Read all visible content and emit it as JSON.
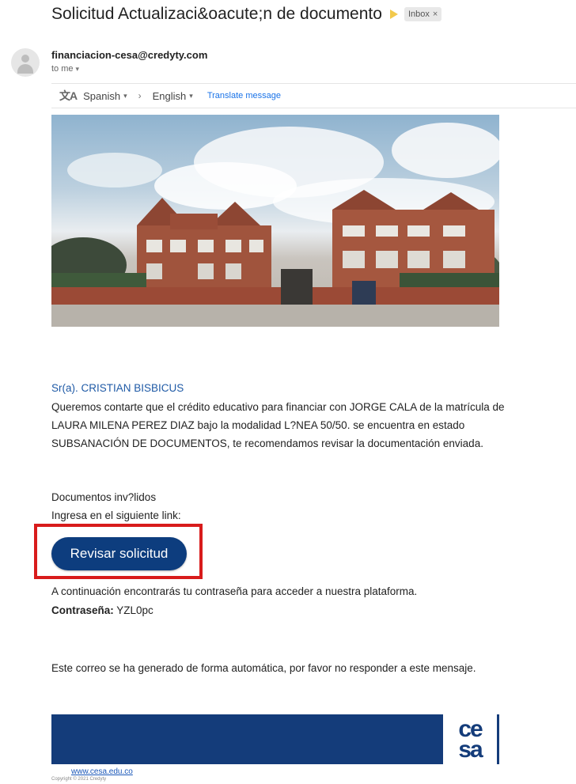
{
  "header": {
    "subject": "Solicitud Actualizaci&oacute;n de documento",
    "inbox_label": "Inbox",
    "inbox_close": "×"
  },
  "sender": {
    "email": "financiacion-cesa@credyty.com",
    "to_label": "to me",
    "to_caret": "▾"
  },
  "translate": {
    "icon": "文A",
    "from_lang": "Spanish",
    "from_caret": "▾",
    "arrow": "›",
    "to_lang": "English",
    "to_caret": "▾",
    "link": "Translate message"
  },
  "message": {
    "greeting": "Sr(a). CRISTIAN BISBICUS",
    "body": "Queremos contarte que el crédito educativo para financiar con JORGE CALA de la matrícula de LAURA MILENA PEREZ DIAZ bajo la modalidad L?NEA 50/50. se encuentra en estado SUBSANACIÓN DE DOCUMENTOS, te recomendamos revisar la documentación enviada.",
    "invalid_docs": "Documentos inv?lidos",
    "link_prompt": "Ingresa en el siguiente link:",
    "cta_label": "Revisar solicitud",
    "password_intro": "A continuación encontrarás tu contraseña para acceder a nuestra plataforma.",
    "password_label": "Contraseña:",
    "password_value": "YZL0pc",
    "auto_notice": "Este correo se ha generado de forma automática, por favor no responder a este mensaje."
  },
  "footer": {
    "logo_top": "ce",
    "logo_bottom": "sa",
    "link": "www.cesa.edu.co",
    "copyright": "Copyright © 2021 Credyty"
  },
  "colors": {
    "cta": "#0d3d7e",
    "highlight": "#d81b1b",
    "footer_band": "#143c7a",
    "greeting": "#1f5aa6",
    "link": "#1a73e8"
  }
}
